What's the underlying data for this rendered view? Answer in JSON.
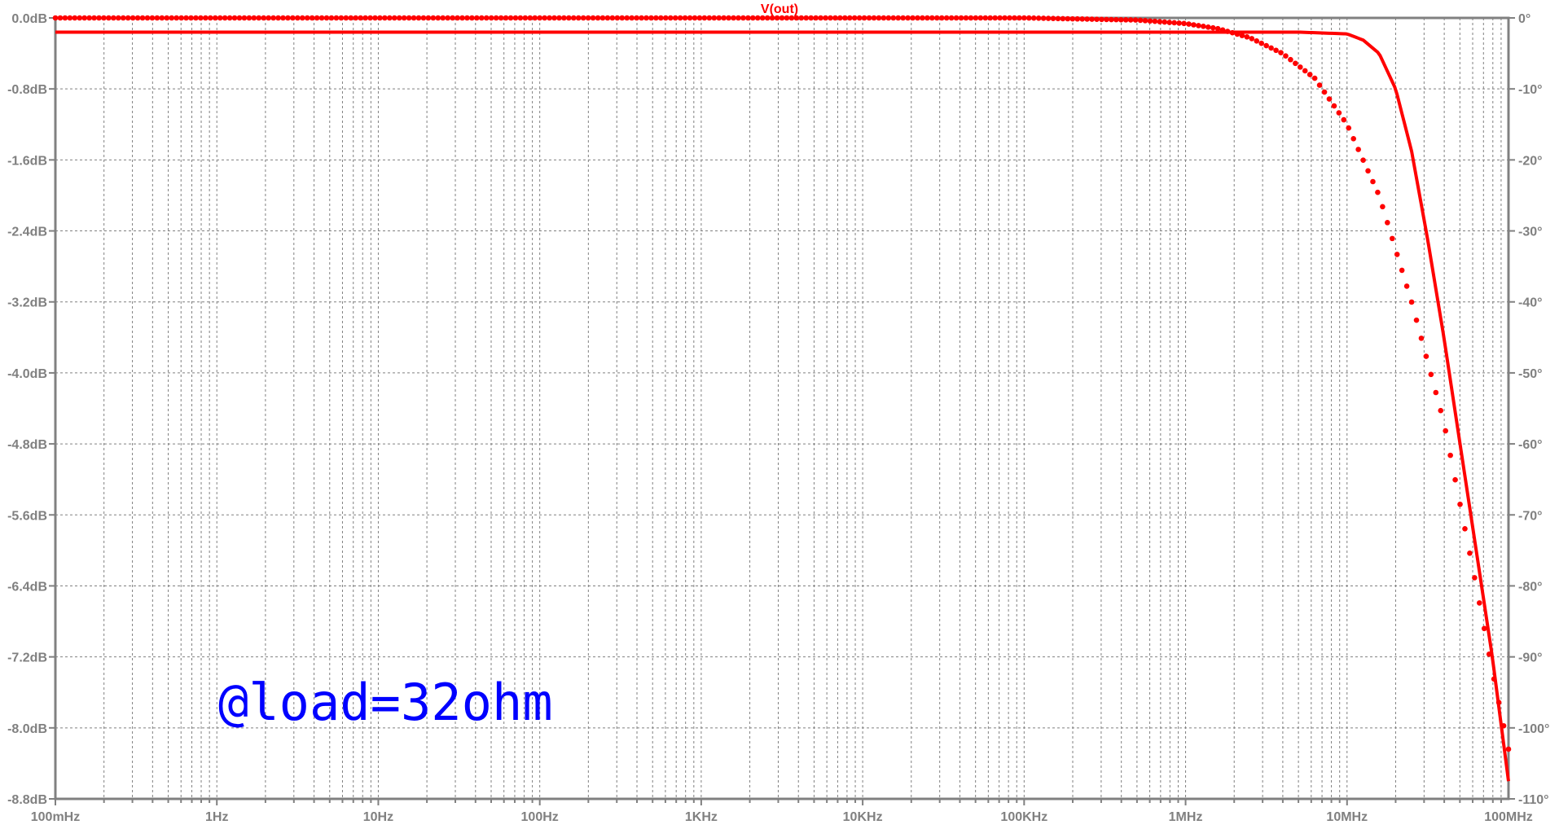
{
  "chart_data": {
    "type": "line",
    "title": "V(out)",
    "annotation": "@load=32ohm",
    "x_scale": "log",
    "xlim": [
      0.1,
      100000000
    ],
    "x_ticks": [
      {
        "value": 0.1,
        "label": "100mHz"
      },
      {
        "value": 1,
        "label": "1Hz"
      },
      {
        "value": 10,
        "label": "10Hz"
      },
      {
        "value": 100,
        "label": "100Hz"
      },
      {
        "value": 1000,
        "label": "1KHz"
      },
      {
        "value": 10000,
        "label": "10KHz"
      },
      {
        "value": 100000,
        "label": "100KHz"
      },
      {
        "value": 1000000,
        "label": "1MHz"
      },
      {
        "value": 10000000,
        "label": "10MHz"
      },
      {
        "value": 100000000,
        "label": "100MHz"
      }
    ],
    "ylim_left": [
      -8.8,
      0.0
    ],
    "y_ticks_left": [
      {
        "value": 0.0,
        "label": "0.0dB"
      },
      {
        "value": -0.8,
        "label": "-0.8dB"
      },
      {
        "value": -1.6,
        "label": "-1.6dB"
      },
      {
        "value": -2.4,
        "label": "-2.4dB"
      },
      {
        "value": -3.2,
        "label": "-3.2dB"
      },
      {
        "value": -4.0,
        "label": "-4.0dB"
      },
      {
        "value": -4.8,
        "label": "-4.8dB"
      },
      {
        "value": -5.6,
        "label": "-5.6dB"
      },
      {
        "value": -6.4,
        "label": "-6.4dB"
      },
      {
        "value": -7.2,
        "label": "-7.2dB"
      },
      {
        "value": -8.0,
        "label": "-8.0dB"
      },
      {
        "value": -8.8,
        "label": "-8.8dB"
      }
    ],
    "ylim_right": [
      -110,
      0
    ],
    "y_ticks_right": [
      {
        "value": 0,
        "label": "0°"
      },
      {
        "value": -10,
        "label": "-10°"
      },
      {
        "value": -20,
        "label": "-20°"
      },
      {
        "value": -30,
        "label": "-30°"
      },
      {
        "value": -40,
        "label": "-40°"
      },
      {
        "value": -50,
        "label": "-50°"
      },
      {
        "value": -60,
        "label": "-60°"
      },
      {
        "value": -70,
        "label": "-70°"
      },
      {
        "value": -80,
        "label": "-80°"
      },
      {
        "value": -90,
        "label": "-90°"
      },
      {
        "value": -100,
        "label": "-100°"
      },
      {
        "value": -110,
        "label": "-110°"
      }
    ],
    "grid": true,
    "series": [
      {
        "axis": "left",
        "style": "solid",
        "color": "#ff0000",
        "x": [
          0.1,
          1000,
          1000000,
          5000000,
          10000000,
          12600000,
          15800000,
          20000000,
          25100000,
          31600000,
          39800000,
          50100000,
          63100000,
          79400000,
          100000000
        ],
        "y": [
          -0.16,
          -0.16,
          -0.16,
          -0.16,
          -0.18,
          -0.25,
          -0.4,
          -0.8,
          -1.5,
          -2.5,
          -3.6,
          -4.8,
          -6.0,
          -7.2,
          -8.6
        ]
      },
      {
        "axis": "right",
        "style": "dotted",
        "color": "#ff0000",
        "x": [
          0.1,
          100000,
          500000,
          1000000,
          1580000,
          2510000,
          3980000,
          6310000,
          10000000,
          15800000,
          25100000,
          39800000,
          63100000,
          79400000,
          100000000
        ],
        "y": [
          0,
          0,
          -0.3,
          -0.8,
          -1.5,
          -2.8,
          -5.0,
          -8.5,
          -15,
          -25,
          -40,
          -57,
          -80,
          -92,
          -103
        ]
      }
    ]
  },
  "colors": {
    "axis": "#808080",
    "grid": "#808080",
    "trace": "#ff0000",
    "annotation": "#0000ff",
    "background": "#ffffff"
  }
}
